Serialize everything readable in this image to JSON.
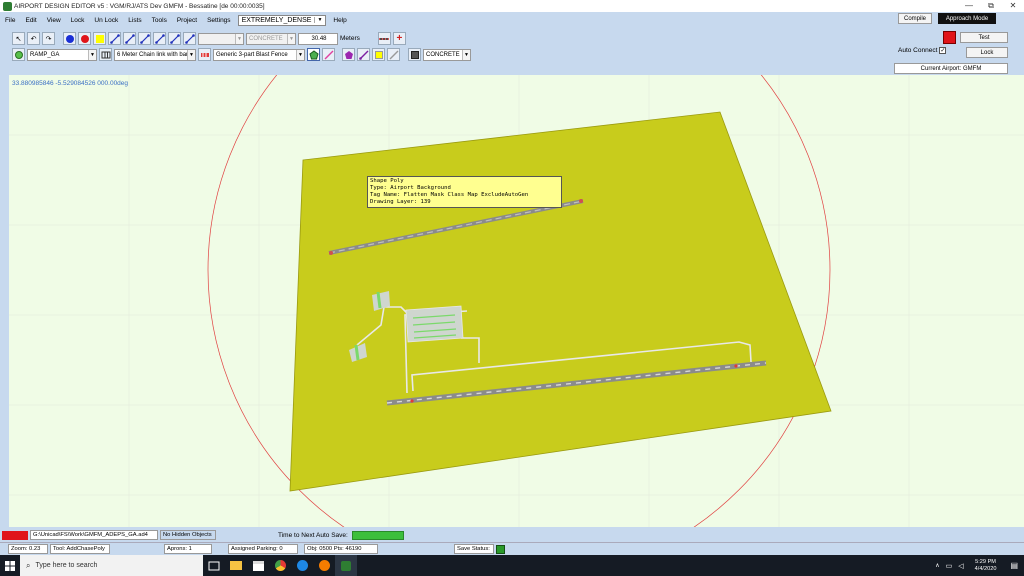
{
  "window": {
    "title": "AIRPORT DESIGN EDITOR v5 : VGM/RJ/ATS Dev GMFM - Bessatine [de 00:00:0035]",
    "controls": [
      "—",
      "⧉",
      "✕"
    ]
  },
  "menu": {
    "items": [
      "File",
      "Edit",
      "View",
      "Lock",
      "Un Lock",
      "Lists",
      "Tools",
      "Project",
      "Settings"
    ],
    "density": "EXTREMELY_DENSE",
    "help": "Help"
  },
  "toolbar1": {
    "surface_combo": "CONCRETE",
    "width_value": "30.48",
    "width_unit": "Meters"
  },
  "toolbar2": {
    "ramp_combo": "RAMP_GA",
    "fence_combo": "6 Meter Chain link with bar",
    "fence2_combo": "Generic 3-part Blast Fence",
    "surface_combo2": "CONCRETE"
  },
  "rightpanel": {
    "compile": "Compile",
    "approach": "Approach Mode",
    "test": "Test",
    "auto_connect": "Auto Connect",
    "lock": "Lock",
    "current_airport": "Current Airport: GMFM"
  },
  "canvas": {
    "coords": "33.880985846 -5.529084526 000.00deg",
    "tooltip": {
      "line1": "Shape Poly",
      "line2": "Type: Airport Background",
      "line3": "Tag Name: Flatten Mask Class Map ExcludeAutoGen",
      "line4": "Drawing Layer: 139"
    }
  },
  "statusbar": {
    "path": "G:\\Unicad\\FS\\Work\\GMFM_ADEPS_GA.ad4",
    "hidden": "No Hidden Objects",
    "autosave": "Time to Next Auto Save:",
    "zoom": "Zoom: 0.23",
    "mode": "Tool: AddChasePoly",
    "aprons": "Aprons: 1",
    "parking": "Assigned Parking: 0",
    "objects": "Obj: 0500 Pts: 46190",
    "save_status": "Save Status:"
  },
  "taskbar": {
    "search_placeholder": "Type here to search",
    "time": "5:29 PM",
    "date": "4/4/2020"
  },
  "colors": {
    "accent_red": "#e0141a",
    "ground": "#c8cc1c",
    "canvas_bg": "#f0fce6",
    "progress_green": "#3cbf3c"
  }
}
